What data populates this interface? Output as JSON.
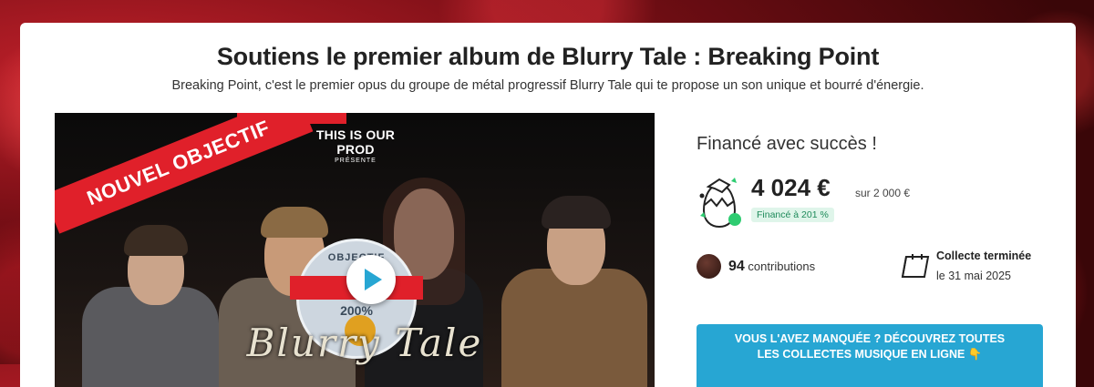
{
  "page": {
    "title": "Soutiens le premier album de Blurry Tale : Breaking Point",
    "subtitle": "Breaking Point, c'est le premier opus du groupe de métal progressif Blurry Tale qui te propose un son unique et bourré d'énergie."
  },
  "media": {
    "ribbon_text": "NOUVEL OBJECTIF",
    "presents_title": "THIS IS OUR PROD",
    "presents_sub": "PRÉSENTE",
    "badge_top": "OBJECTIF",
    "badge_pct": "200%",
    "band_logo": "Blurry Tale"
  },
  "funding": {
    "status": "Financé avec succès !",
    "amount": "4 024 €",
    "goal": "sur 2 000 €",
    "percent": "Financé à 201 %",
    "contributions_count": "94",
    "contributions_label": "contributions",
    "collecte_title": "Collecte terminée",
    "collecte_date": "le 31 mai 2025"
  },
  "cta": {
    "line1": "VOUS L'AVEZ MANQUÉE ? DÉCOUVREZ TOUTES",
    "line2": "LES COLLECTES MUSIQUE EN LIGNE 👇"
  },
  "colors": {
    "accent": "#27a6d3",
    "success_bg": "#dff5ea",
    "success_text": "#1e8a5a",
    "ribbon": "#e0202a"
  }
}
